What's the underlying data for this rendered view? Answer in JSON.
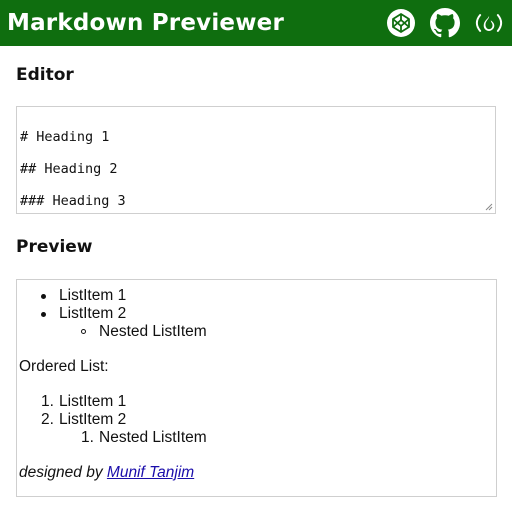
{
  "app": {
    "title": "Markdown Previewer",
    "header_color": "#0f6e0f",
    "icons": [
      "codepen-icon",
      "github-icon",
      "freecodecamp-icon"
    ]
  },
  "editor": {
    "heading": "Editor",
    "lines": [
      "# Heading 1",
      "## Heading 2",
      "### Heading 3"
    ]
  },
  "preview": {
    "heading": "Preview",
    "unordered": [
      "ListItem 1",
      "ListItem 2"
    ],
    "unordered_nested": "Nested ListItem",
    "ordered_label": "Ordered List:",
    "ordered": [
      {
        "num": "1.",
        "text": "ListItem 1"
      },
      {
        "num": "2.",
        "text": "ListItem 2"
      }
    ],
    "ordered_nested": {
      "num": "1.",
      "text": "Nested ListItem"
    },
    "credit_prefix": "designed by",
    "credit_link": "Munif Tanjim"
  }
}
